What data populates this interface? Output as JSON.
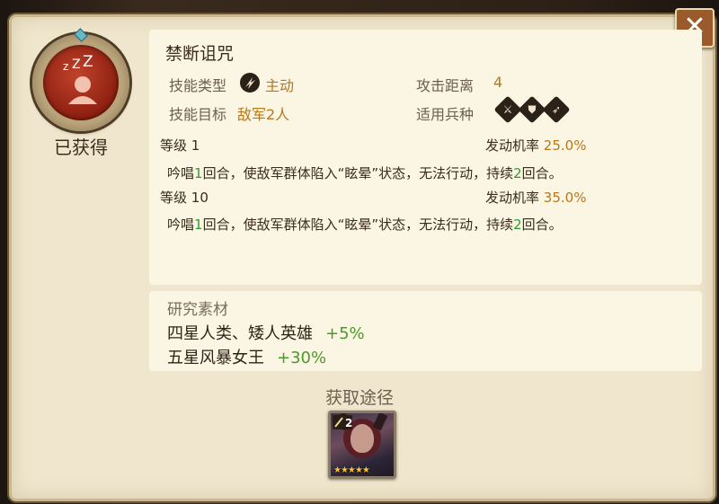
{
  "close_button": {
    "label": "✕"
  },
  "skill": {
    "status": "已获得",
    "name": "禁断诅咒",
    "type_label": "技能类型",
    "type_value": "主动",
    "range_label": "攻击距离",
    "range_value": "4",
    "target_label": "技能目标",
    "target_value": "敌军2人",
    "unit_types_label": "适用兵种",
    "unit_type_icons": [
      "sword-icon",
      "shield-icon",
      "bow-icon"
    ],
    "levels": [
      {
        "level_label": "等级",
        "level": "1",
        "rate_label": "发动机率",
        "rate": "25.0%",
        "desc_pre": "吟唱",
        "desc_cast": "1",
        "desc_mid": "回合，使敌军群体陷入“眩晕”状态，无法行动，持续",
        "desc_dur": "2",
        "desc_post": "回合。"
      },
      {
        "level_label": "等级",
        "level": "10",
        "rate_label": "发动机率",
        "rate": "35.0%",
        "desc_pre": "吟唱",
        "desc_cast": "1",
        "desc_mid": "回合，使敌军群体陷入“眩晕”状态，无法行动，持续",
        "desc_dur": "2",
        "desc_post": "回合。"
      }
    ]
  },
  "materials": {
    "title": "研究素材",
    "items": [
      {
        "name": "四星人类、矮人英雄",
        "bonus": "+5%"
      },
      {
        "name": "五星风暴女王",
        "bonus": "+30%"
      }
    ]
  },
  "source": {
    "title": "获取途径",
    "hero_level": "2",
    "hero_stars": "★★★★★"
  },
  "colors": {
    "accent": "#b9771b",
    "green": "#2f9a34",
    "panel": "#efe6cd",
    "close": "#9a5a2c"
  }
}
